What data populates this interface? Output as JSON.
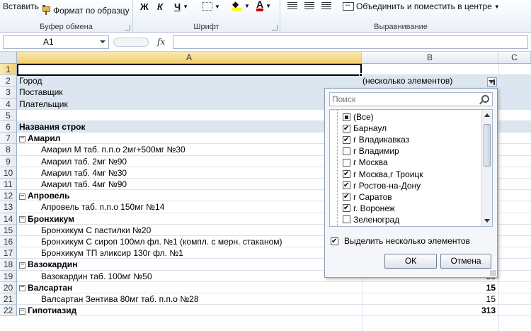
{
  "ribbon": {
    "paste_label": "Вставить",
    "format_painter_label": "Формат по образцу",
    "clipboard_group": "Буфер обмена",
    "bold_glyph": "Ж",
    "italic_glyph": "К",
    "underline_glyph": "Ч",
    "font_group": "Шрифт",
    "merge_label": "Объединить и поместить в центре",
    "alignment_group": "Выравнивание"
  },
  "formula_bar": {
    "name_box": "A1",
    "fx_label": "fx",
    "formula": ""
  },
  "columns": [
    "A",
    "B",
    "C"
  ],
  "rows": [
    {
      "n": "1",
      "a": "",
      "b": ""
    },
    {
      "n": "2",
      "a": "Город",
      "b": "(несколько элементов)"
    },
    {
      "n": "3",
      "a": "Поставщик",
      "b": ""
    },
    {
      "n": "4",
      "a": "Плательщик",
      "b": ""
    },
    {
      "n": "5",
      "a": "",
      "b": ""
    },
    {
      "n": "6",
      "a": "Названия строк",
      "b": ""
    },
    {
      "n": "7",
      "a": "Амарил",
      "b": ""
    },
    {
      "n": "8",
      "a": "Амарил М таб. п.п.о 2мг+500мг №30",
      "b": ""
    },
    {
      "n": "9",
      "a": "Амарил таб. 2мг №90",
      "b": ""
    },
    {
      "n": "10",
      "a": "Амарил таб. 4мг №30",
      "b": ""
    },
    {
      "n": "11",
      "a": "Амарил таб. 4мг №90",
      "b": ""
    },
    {
      "n": "12",
      "a": "Апровель",
      "b": ""
    },
    {
      "n": "13",
      "a": "Апровель таб. п.п.о 150мг №14",
      "b": ""
    },
    {
      "n": "14",
      "a": "Бронхикум",
      "b": ""
    },
    {
      "n": "15",
      "a": "Бронхикум С пастилки №20",
      "b": ""
    },
    {
      "n": "16",
      "a": "Бронхикум С сироп 100мл фл. №1 (компл. с мерн. стаканом)",
      "b": ""
    },
    {
      "n": "17",
      "a": "Бронхикум ТП эликсир 130г фл. №1",
      "b": ""
    },
    {
      "n": "18",
      "a": "Вазокардин",
      "b": ""
    },
    {
      "n": "19",
      "a": "Вазокардин таб. 100мг №50",
      "b": "30"
    },
    {
      "n": "20",
      "a": "Валсартан",
      "b": "15"
    },
    {
      "n": "21",
      "a": "Валсартан Зентива 80мг таб. п.п.о №28",
      "b": "15"
    },
    {
      "n": "22",
      "a": "Гипотиазид",
      "b": "313"
    }
  ],
  "filter_panel": {
    "search_placeholder": "Поиск",
    "items": [
      {
        "label": "(Все)",
        "state": "partial"
      },
      {
        "label": "Барнаул",
        "state": "checked"
      },
      {
        "label": "г Владикавказ",
        "state": "checked"
      },
      {
        "label": "г Владимир",
        "state": "unchecked"
      },
      {
        "label": "г Москва",
        "state": "unchecked"
      },
      {
        "label": "г Москва,г Троицк",
        "state": "checked"
      },
      {
        "label": "г Ростов-на-Дону",
        "state": "checked"
      },
      {
        "label": "г Саратов",
        "state": "checked"
      },
      {
        "label": "г. Воронеж",
        "state": "checked"
      },
      {
        "label": "Зеленоград",
        "state": "unchecked"
      }
    ],
    "multi_select_label": "Выделить несколько элементов",
    "ok_label": "ОК",
    "cancel_label": "Отмена"
  }
}
